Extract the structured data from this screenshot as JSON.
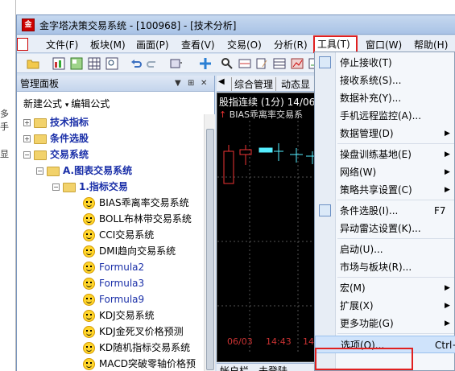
{
  "background_window": {
    "texts": [
      "多手",
      "显"
    ]
  },
  "window": {
    "title": "金字塔决策交易系统 - [100968] - [技术分析]"
  },
  "menubar": [
    {
      "label": "文件(F)"
    },
    {
      "label": "板块(M)"
    },
    {
      "label": "画面(P)"
    },
    {
      "label": "查看(V)"
    },
    {
      "label": "交易(O)"
    },
    {
      "label": "分析(R)"
    },
    {
      "label": "工具(T)"
    },
    {
      "label": "窗口(W)"
    },
    {
      "label": "帮助(H)"
    }
  ],
  "panel": {
    "title": "管理面板",
    "controls": [
      "▼",
      "⊞",
      "✕"
    ],
    "new_formula": "新建公式",
    "edit_formula": "编辑公式"
  },
  "tree": [
    {
      "label": "技术指标",
      "kind": "root"
    },
    {
      "label": "条件选股",
      "kind": "root"
    },
    {
      "label": "交易系统",
      "kind": "root-open"
    },
    {
      "label": "A.图表交易系统",
      "kind": "folder-open"
    },
    {
      "label": "1.指标交易",
      "kind": "folder-open"
    },
    {
      "label": "BIAS乖离率交易系统",
      "kind": "item"
    },
    {
      "label": "BOLL布林带交易系统",
      "kind": "item"
    },
    {
      "label": "CCI交易系统",
      "kind": "item"
    },
    {
      "label": "DMI趋向交易系统",
      "kind": "item"
    },
    {
      "label": "Formula2",
      "kind": "item-link"
    },
    {
      "label": "Formula3",
      "kind": "item-link"
    },
    {
      "label": "Formula9",
      "kind": "item-link"
    },
    {
      "label": "KDJ交易系统",
      "kind": "item"
    },
    {
      "label": "KDJ金死叉价格预测",
      "kind": "item"
    },
    {
      "label": "KD随机指标交易系统",
      "kind": "item"
    },
    {
      "label": "MACD突破零轴价格预",
      "kind": "item"
    }
  ],
  "tabs": [
    {
      "label": "综合管理"
    },
    {
      "label": "动态显"
    }
  ],
  "chart": {
    "header": "股指连续 (1分) 14/06",
    "subheader": "BIAS乖离率交易系",
    "dates": [
      "06/03",
      "14:43",
      "14"
    ]
  },
  "account_bar": "帐户栏 - 未登陆",
  "tools_menu": [
    {
      "label": "停止接收(T)",
      "has_icon": true
    },
    {
      "label": "接收系统(S)..."
    },
    {
      "label": "数据补充(Y)..."
    },
    {
      "label": "手机远程监控(A)..."
    },
    {
      "label": "数据管理(D)",
      "submenu": true
    },
    {
      "sep": true
    },
    {
      "label": "操盘训练基地(E)",
      "submenu": true
    },
    {
      "label": "网络(W)",
      "submenu": true
    },
    {
      "label": "策略共享设置(C)",
      "submenu": true
    },
    {
      "sep": true
    },
    {
      "label": "条件选股(I)...",
      "shortcut": "F7",
      "has_icon": true
    },
    {
      "label": "异动雷达设置(K)..."
    },
    {
      "sep": true
    },
    {
      "label": "启动(U)..."
    },
    {
      "label": "市场与板块(R)..."
    },
    {
      "sep": true
    },
    {
      "label": "宏(M)",
      "submenu": true
    },
    {
      "label": "扩展(X)",
      "submenu": true
    },
    {
      "label": "更多功能(G)",
      "submenu": true
    },
    {
      "sep": true
    },
    {
      "label": "选项(O)...",
      "shortcut": "Ctrl+O",
      "highlight": true
    }
  ],
  "colors": {
    "highlight_box": "#e02020",
    "chart_bg": "#000000",
    "tree_root": "#1a2fa8"
  }
}
